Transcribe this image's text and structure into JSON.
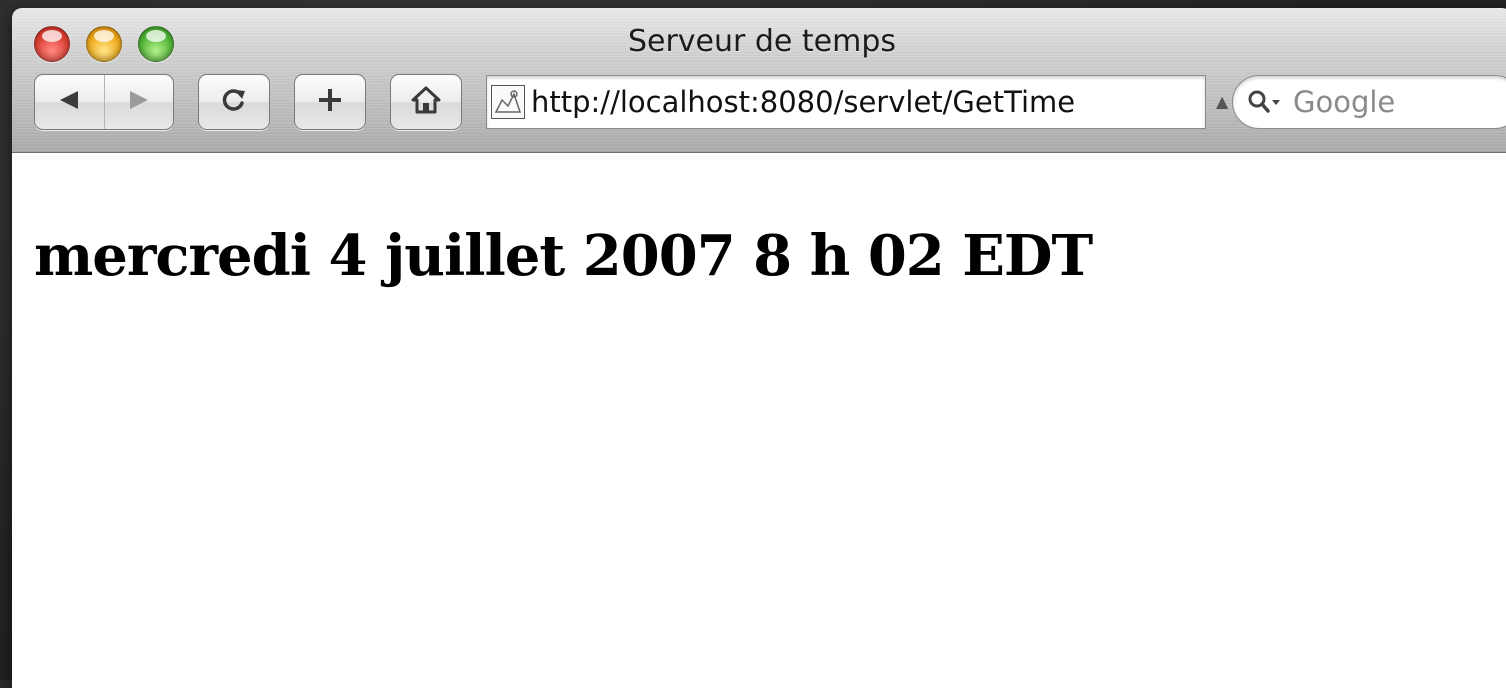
{
  "window": {
    "title": "Serveur de temps"
  },
  "toolbar": {
    "back_icon": "back-arrow-icon",
    "forward_icon": "forward-arrow-icon",
    "reload_icon": "reload-icon",
    "add_bookmark_label": "+",
    "home_icon": "home-icon"
  },
  "address_bar": {
    "url": "http://localhost:8080/servlet/GetTime"
  },
  "search": {
    "placeholder": "Google"
  },
  "page": {
    "heading": "mercredi 4 juillet 2007 8 h 02 EDT"
  },
  "colors": {
    "close": "#e0443a",
    "minimize": "#f0ad1f",
    "zoom": "#55b83a"
  }
}
